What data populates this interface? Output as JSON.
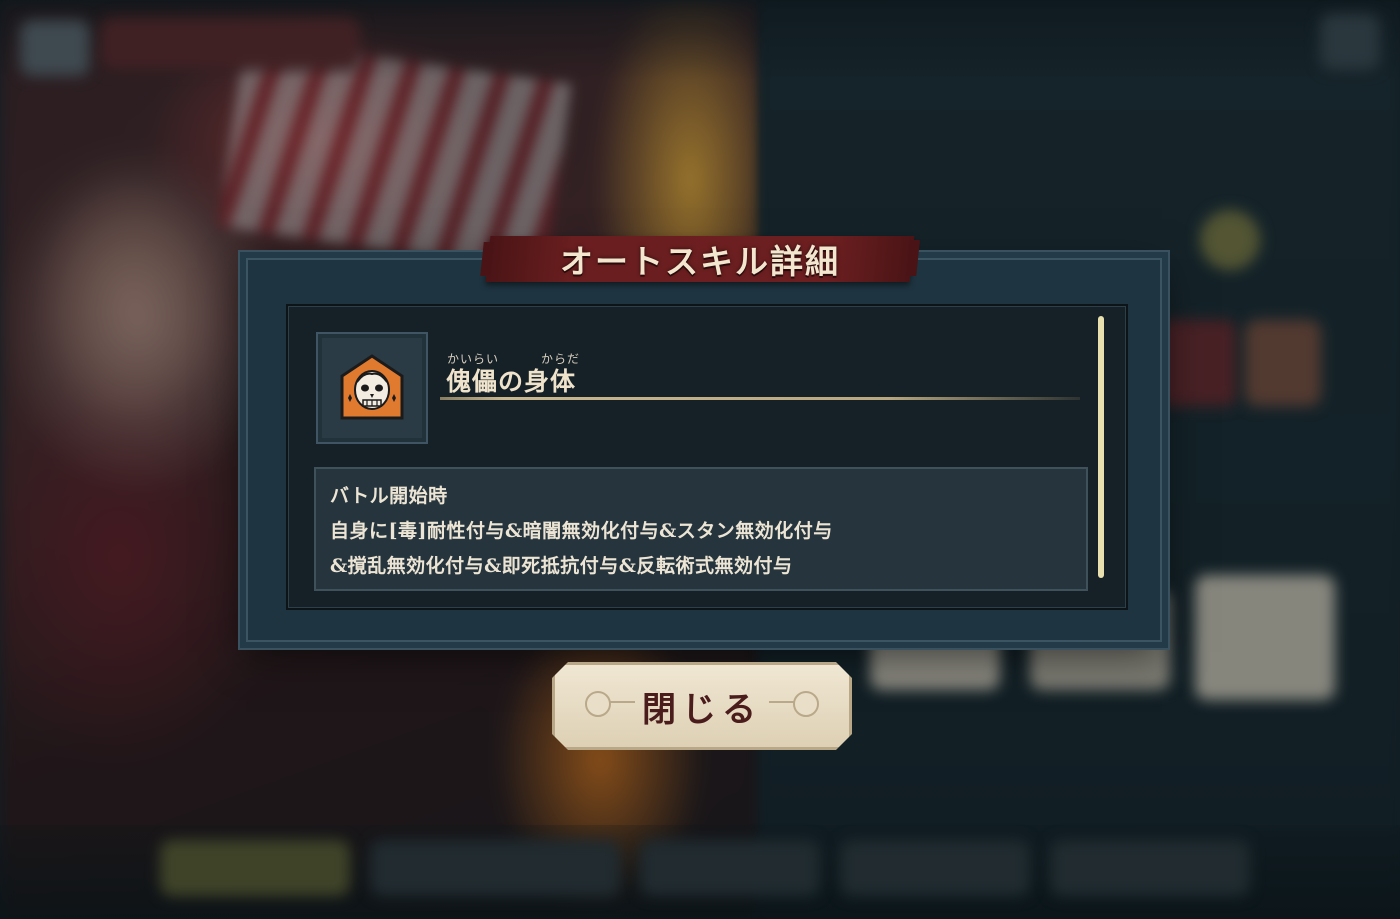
{
  "dialog": {
    "title": "オートスキル詳細",
    "skill": {
      "icon": "skull-mask-icon",
      "name": "傀儡の身体",
      "ruby_1": "かいらい",
      "ruby_2": "からだ"
    },
    "description": {
      "line1": "バトル開始時",
      "line2": "自身に[毒]耐性付与&暗闇無効化付与&スタン無効化付与",
      "line3": "&撹乱無効化付与&即死抵抗付与&反転術式無効付与"
    },
    "close_label": "閉じる"
  },
  "colors": {
    "banner": "#6a1e1f",
    "icon_bg": "#e07a2e",
    "scroll_thumb": "#e9e0b0"
  }
}
